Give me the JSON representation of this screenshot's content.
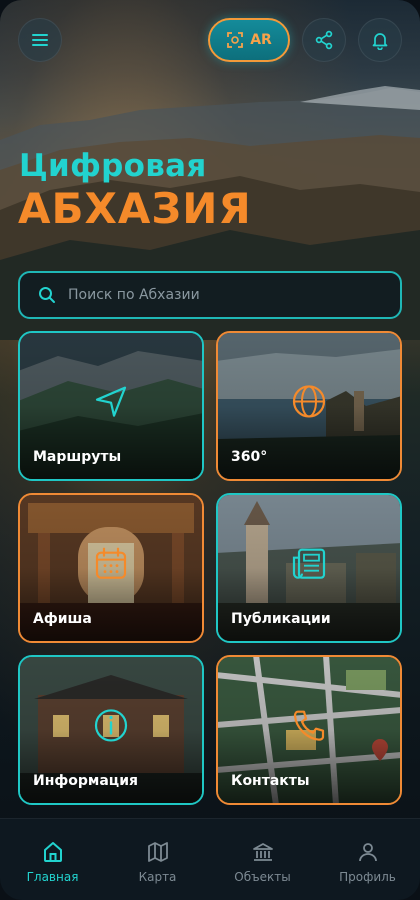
{
  "header": {
    "ar_label": "AR"
  },
  "hero": {
    "title_line1": "Цифровая",
    "title_line2": "АБХАЗИЯ"
  },
  "search": {
    "placeholder": "Поиск по Абхазии"
  },
  "cards": [
    {
      "label": "Маршруты",
      "icon": "navigation-arrow-icon",
      "accent": "#1fc7c5"
    },
    {
      "label": "360°",
      "icon": "globe-icon",
      "accent": "#f08a35"
    },
    {
      "label": "Афиша",
      "icon": "calendar-icon",
      "accent": "#f08a35"
    },
    {
      "label": "Публикации",
      "icon": "newspaper-icon",
      "accent": "#1fc7c5"
    },
    {
      "label": "Информация",
      "icon": "info-icon",
      "accent": "#1fc7c5"
    },
    {
      "label": "Контакты",
      "icon": "phone-icon",
      "accent": "#f08a35"
    }
  ],
  "nav": [
    {
      "label": "Главная",
      "icon": "home-icon",
      "active": true
    },
    {
      "label": "Карта",
      "icon": "map-icon",
      "active": false
    },
    {
      "label": "Объекты",
      "icon": "building-icon",
      "active": false
    },
    {
      "label": "Профиль",
      "icon": "user-icon",
      "active": false
    }
  ],
  "colors": {
    "teal": "#22d3cf",
    "orange": "#f58a2a",
    "background": "#0a1016"
  }
}
